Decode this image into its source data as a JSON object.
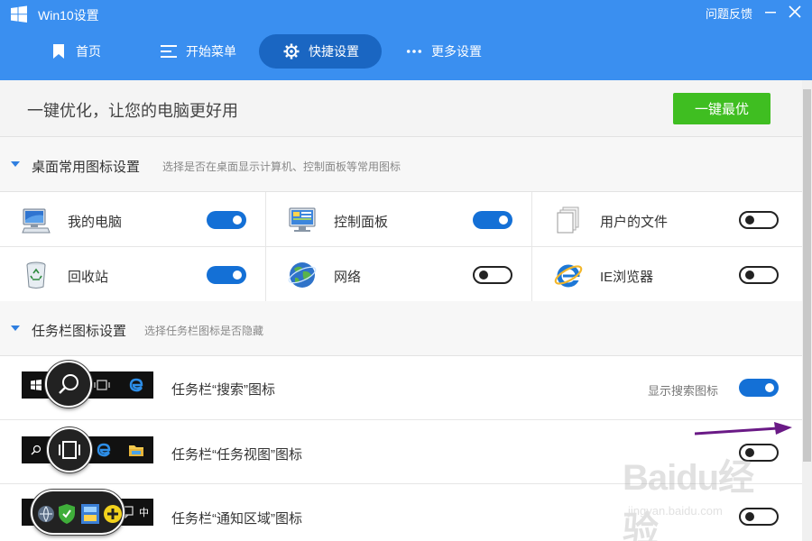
{
  "header": {
    "app_title": "Win10设置",
    "feedback": "问题反馈",
    "nav": [
      {
        "label": "首页",
        "icon": "bookmark-icon"
      },
      {
        "label": "开始菜单",
        "icon": "menu-lines-icon"
      },
      {
        "label": "快捷设置",
        "icon": "gear-icon",
        "active": true
      },
      {
        "label": "更多设置",
        "icon": "more-dots-icon"
      }
    ]
  },
  "banner": {
    "text": "一键优化，让您的电脑更好用",
    "button": "一键最优"
  },
  "desktop_section": {
    "title": "桌面常用图标设置",
    "desc": "选择是否在桌面显示计算机、控制面板等常用图标",
    "items": [
      {
        "label": "我的电脑",
        "icon": "computer-icon",
        "on": true
      },
      {
        "label": "控制面板",
        "icon": "control-panel-icon",
        "on": true
      },
      {
        "label": "用户的文件",
        "icon": "user-files-icon",
        "on": false
      },
      {
        "label": "回收站",
        "icon": "recycle-bin-icon",
        "on": true
      },
      {
        "label": "网络",
        "icon": "network-globe-icon",
        "on": false
      },
      {
        "label": "IE浏览器",
        "icon": "ie-browser-icon",
        "on": false
      }
    ]
  },
  "taskbar_section": {
    "title": "任务栏图标设置",
    "desc": "选择任务栏图标是否隐藏",
    "rows": [
      {
        "label": "任务栏“搜索”图标",
        "sub": "显示搜索图标",
        "on": true
      },
      {
        "label": "任务栏“任务视图”图标",
        "sub": "",
        "on": false
      },
      {
        "label": "任务栏“通知区域”图标",
        "sub": "",
        "on": false
      }
    ],
    "tray_text": "中"
  },
  "colors": {
    "header": "#3a8ff0",
    "active_nav": "#1a66c2",
    "accent_green": "#3fbe21",
    "toggle_on": "#1470d6"
  },
  "watermark": {
    "brand": "Baidu经验",
    "url": "jingyan.baidu.com"
  }
}
